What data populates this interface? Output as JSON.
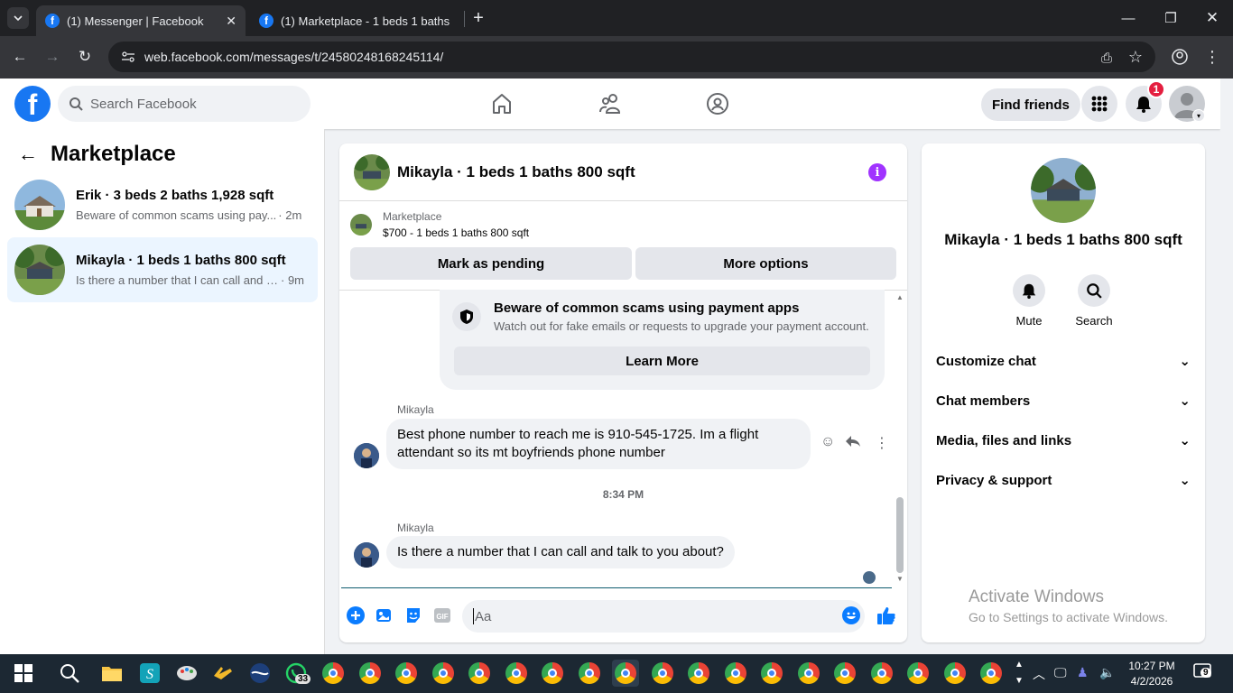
{
  "browser": {
    "tabs": [
      {
        "title": "(1) Messenger | Facebook",
        "active": true
      },
      {
        "title": "(1) Marketplace - 1 beds 1 baths",
        "active": false
      }
    ],
    "url": "web.facebook.com/messages/t/24580248168245114/"
  },
  "header": {
    "search_placeholder": "Search Facebook",
    "find_friends": "Find friends",
    "notification_count": "1"
  },
  "left": {
    "title": "Marketplace",
    "conversations": [
      {
        "name": "Erik · 3 beds 2 baths 1,928 sqft",
        "preview": "Beware of common scams using pay...",
        "time": "· 2m",
        "active": false
      },
      {
        "name": "Mikayla · 1 beds 1 baths 800 sqft",
        "preview": "Is there a number that I can call and t...",
        "time": "· 9m",
        "active": true
      }
    ]
  },
  "chat": {
    "title": "Mikayla · 1 beds 1 baths 800 sqft",
    "marketplace_label": "Marketplace",
    "listing": "$700 - 1 beds 1 baths 800 sqft",
    "mark_pending": "Mark as pending",
    "more_options": "More options",
    "scam_title": "Beware of common scams using payment apps",
    "scam_desc": "Watch out for fake emails or requests to upgrade your payment account.",
    "learn_more": "Learn More",
    "messages": [
      {
        "sender": "Mikayla",
        "text": "Best phone number to reach me is 910-545-1725. Im a flight attendant so its mt boyfriends phone number"
      },
      {
        "sender": "Mikayla",
        "text": "Is there a number that I can call and talk to you about?"
      }
    ],
    "timestamp": "8:34 PM",
    "input_placeholder": "Aa"
  },
  "right": {
    "name": "Mikayla · 1 beds 1 baths 800 sqft",
    "mute": "Mute",
    "search": "Search",
    "sections": [
      "Customize chat",
      "Chat members",
      "Media, files and links",
      "Privacy & support"
    ]
  },
  "watermark": {
    "line1": "Activate Windows",
    "line2": "Go to Settings to activate Windows."
  },
  "taskbar": {
    "whatsapp_badge": "33",
    "time": "10:27 PM",
    "date": "4/2/2026",
    "notif_count": "9"
  },
  "colors": {
    "fb_blue": "#1877f2",
    "info_purple": "#a033ff",
    "badge_red": "#e41e3f"
  }
}
